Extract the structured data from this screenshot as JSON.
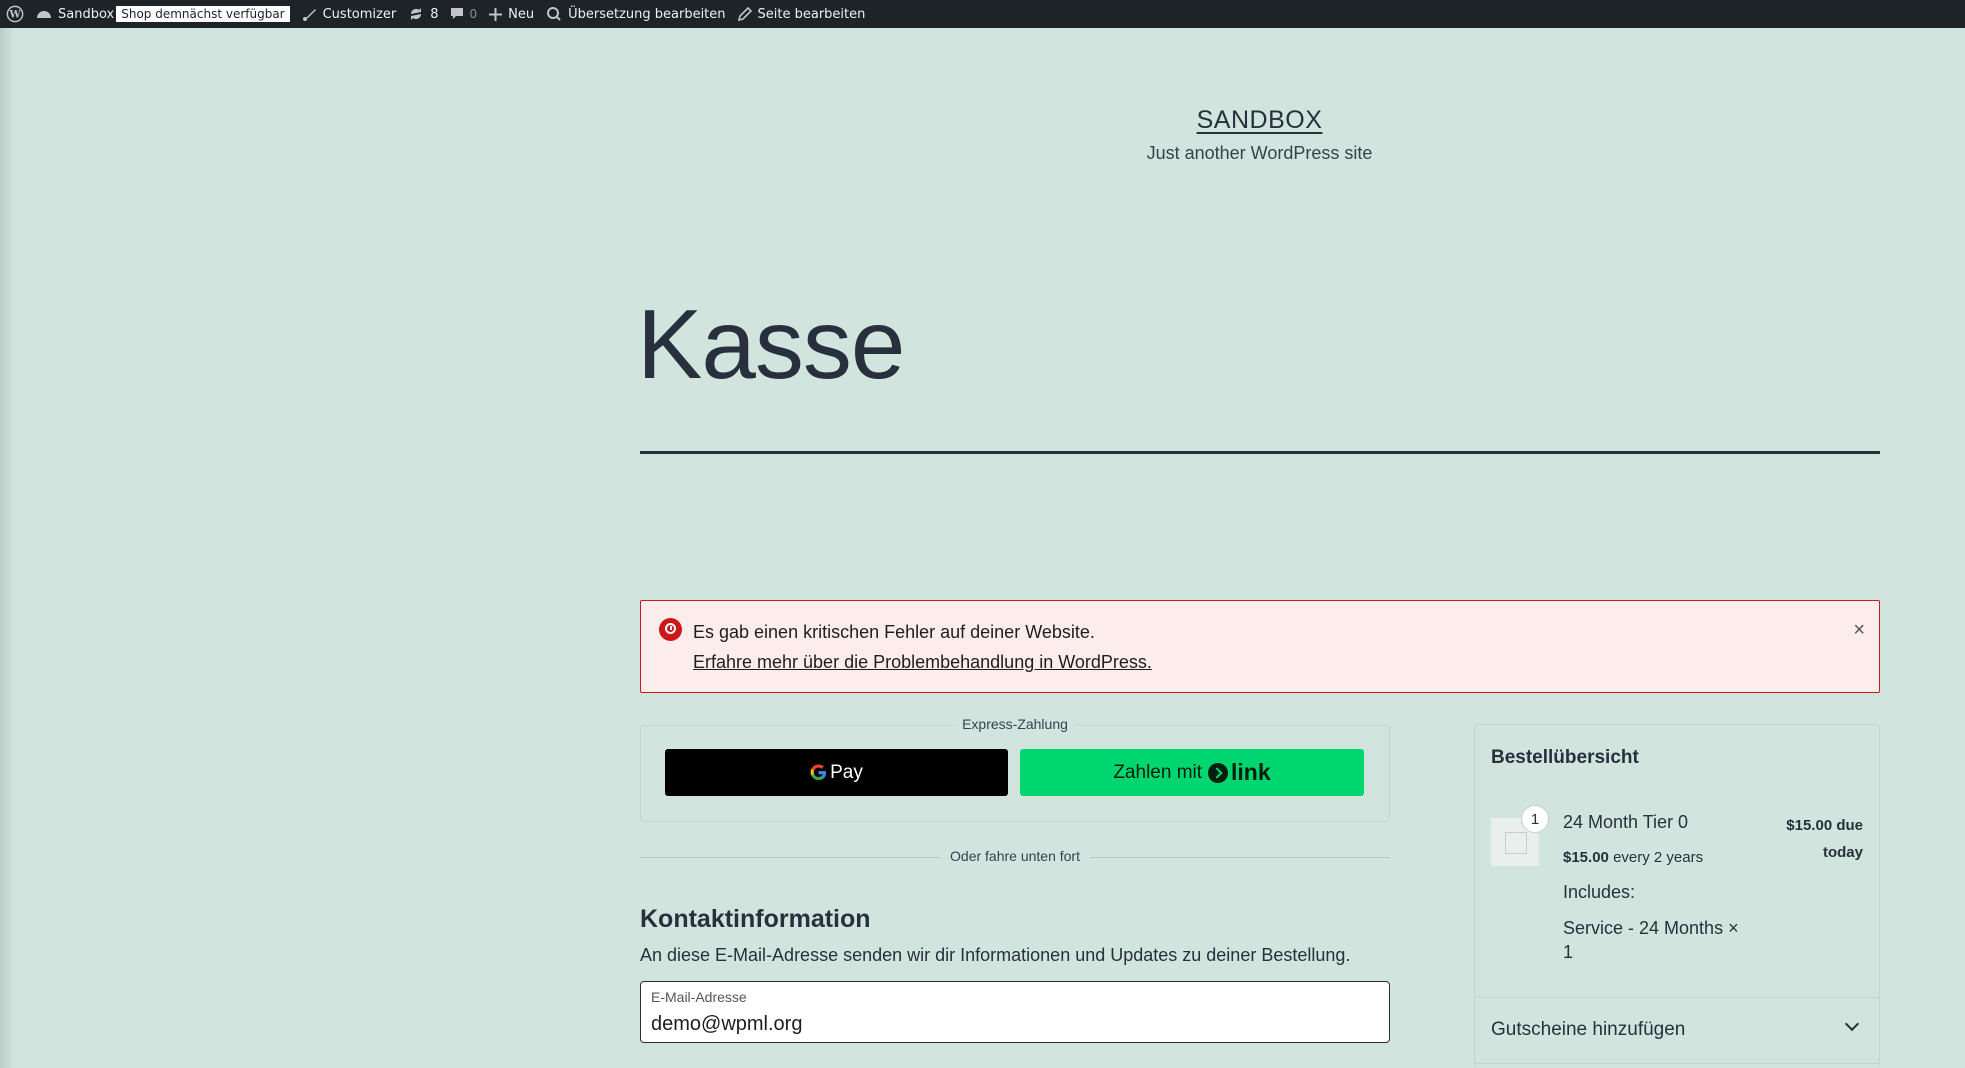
{
  "adminbar": {
    "site_name": "Sandbox",
    "badge": "Shop demnächst verfügbar",
    "customizer": "Customizer",
    "updates_count": "8",
    "comments_count": "0",
    "new": "Neu",
    "translation": "Übersetzung bearbeiten",
    "edit_page": "Seite bearbeiten"
  },
  "header": {
    "site_title": "SANDBOX",
    "site_description": "Just another WordPress site"
  },
  "page": {
    "title": "Kasse"
  },
  "notice": {
    "text": "Es gab einen kritischen Fehler auf deiner Website.",
    "link": "Erfahre mehr über die Problembehandlung in WordPress.",
    "close": "×"
  },
  "express": {
    "legend": "Express-Zahlung",
    "gpay_label": "Pay",
    "link_prefix": "Zahlen mit",
    "link_word": "link",
    "divider": "Oder fahre unten fort"
  },
  "contact": {
    "heading": "Kontaktinformation",
    "description": "An diese E-Mail-Adresse senden wir dir Informationen und Updates zu deiner Bestellung.",
    "email_label": "E-Mail-Adresse",
    "email_value": "demo@wpml.org"
  },
  "summary": {
    "title": "Bestellübersicht",
    "item": {
      "quantity": "1",
      "name": "24 Month Tier 0",
      "price_line1": "$15.00 due",
      "price_line2": "today",
      "sub_price": "$15.00",
      "sub_period": "every 2 years",
      "includes": "Includes:",
      "service": "Service - 24 Months × 1"
    },
    "coupon": "Gutscheine hinzufügen"
  },
  "colors": {
    "background": "#d1e4dd",
    "adminbar": "#1d2327",
    "error": "#cc1818",
    "link_green": "#00d66f"
  }
}
